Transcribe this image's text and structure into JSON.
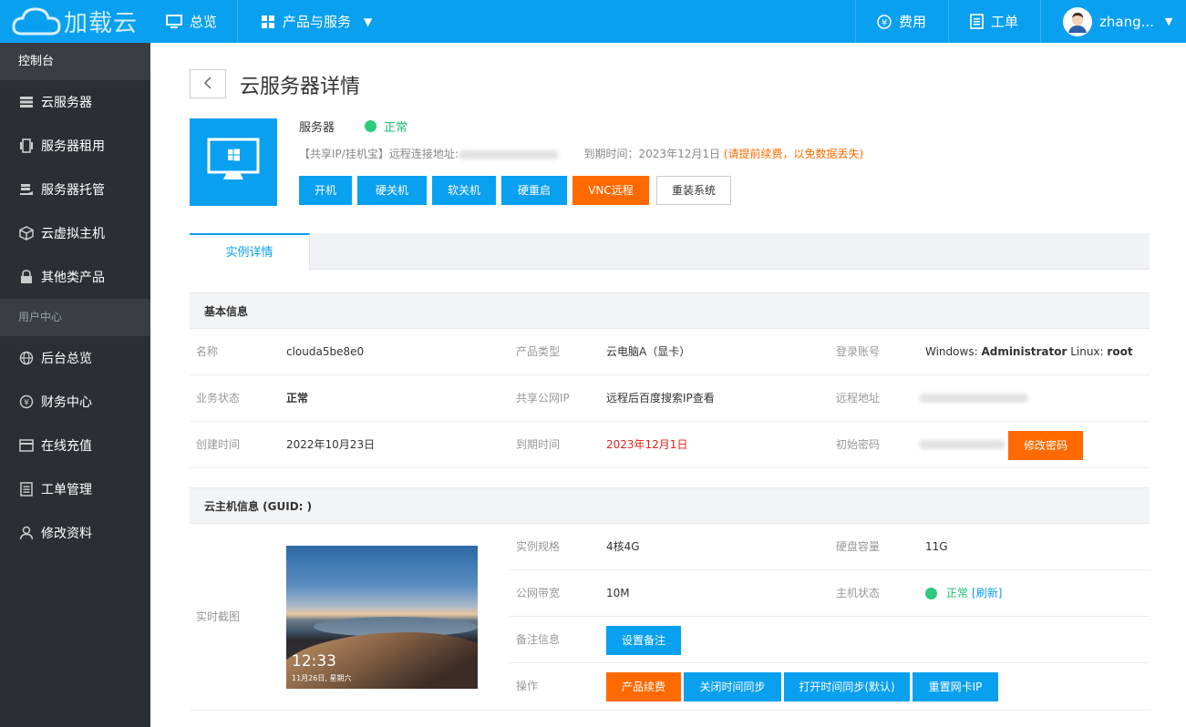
{
  "brand": {
    "name": "加载云"
  },
  "topnav": {
    "overview": "总览",
    "products": "产品与服务",
    "billing": "费用",
    "ticket": "工单",
    "user": "zhang..."
  },
  "sidebar": {
    "section1": "控制台",
    "items1": [
      "云服务器",
      "服务器租用",
      "服务器托管",
      "云虚拟主机",
      "其他类产品"
    ],
    "section2": "用户中心",
    "items2": [
      "后台总览",
      "财务中心",
      "在线充值",
      "工单管理",
      "修改资料"
    ]
  },
  "page": {
    "title": "云服务器详情",
    "server_label": "服务器",
    "status": "正常",
    "info_prefix": "【共享IP/挂机宝】远程连接地址:",
    "expire_label": "到期时间：2023年12月1日",
    "expire_warn": "(请提前续费，以免数据丢失)"
  },
  "actions": {
    "power_on": "开机",
    "hard_off": "硬关机",
    "soft_off": "软关机",
    "hard_reboot": "硬重启",
    "vnc": "VNC远程",
    "reinstall": "重装系统"
  },
  "tabs": {
    "active": "实例详情"
  },
  "basic": {
    "heading": "基本信息",
    "name_label": "名称",
    "name_value": "clouda5be8e0",
    "type_label": "产品类型",
    "type_value": "云电脑A（显卡）",
    "account_label": "登录账号",
    "account_win_prefix": "Windows: ",
    "account_win": "Administrator",
    "account_linux_prefix": " Linux: ",
    "account_linux": "root",
    "biz_status_label": "业务状态",
    "biz_status_value": "正常",
    "shared_ip_label": "共享公网IP",
    "shared_ip_value": "远程后百度搜索IP查看",
    "remote_label": "远程地址",
    "created_label": "创建时间",
    "created_value": "2022年10月23日",
    "expire_label": "到期时间",
    "expire_value": "2023年12月1日",
    "password_label": "初始密码",
    "change_password": "修改密码"
  },
  "host": {
    "heading": "云主机信息 (GUID: )",
    "screenshot_label": "实时截图",
    "screenshot_time": "12:33",
    "screenshot_date": "11月26日, 星期六",
    "spec_label": "实例规格",
    "spec_value": "4核4G",
    "disk_label": "硬盘容量",
    "disk_value": "11G",
    "bandwidth_label": "公网带宽",
    "bandwidth_value": "10M",
    "host_status_label": "主机状态",
    "host_status_value": "正常",
    "refresh": "[刷新]",
    "note_label": "备注信息",
    "set_note": "设置备注",
    "ops_label": "操作",
    "renew": "产品续费",
    "disable_sync": "关闭时间同步",
    "enable_sync": "打开时间同步(默认)",
    "reset_nic": "重置网卡IP"
  },
  "colors": {
    "primary": "#0aa0f0",
    "orange": "#ff6a00",
    "sidebar": "#2b2f33",
    "success": "#2ec97a"
  }
}
